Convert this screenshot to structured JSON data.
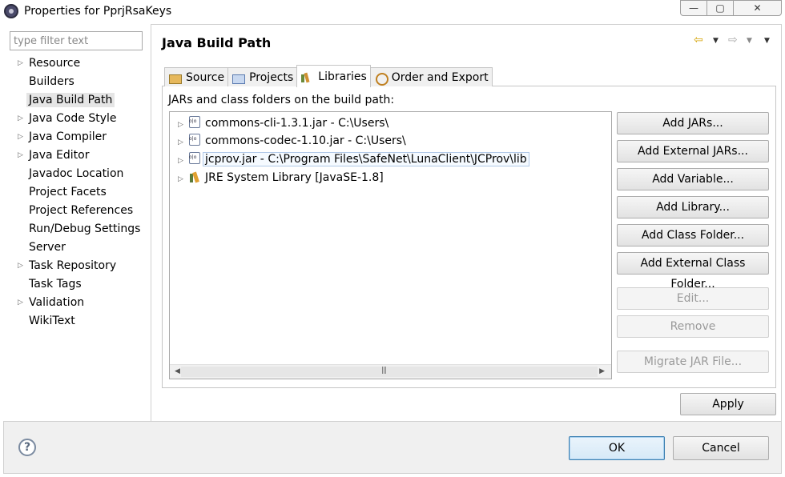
{
  "window": {
    "title": "Properties for PprjRsaKeys",
    "minimize": "—",
    "maximize": "▢",
    "close": "✕"
  },
  "nav": {
    "filter_placeholder": "type filter text",
    "items": [
      {
        "label": "Resource",
        "expandable": true
      },
      {
        "label": "Builders",
        "expandable": false
      },
      {
        "label": "Java Build Path",
        "expandable": false,
        "selected": true
      },
      {
        "label": "Java Code Style",
        "expandable": true
      },
      {
        "label": "Java Compiler",
        "expandable": true
      },
      {
        "label": "Java Editor",
        "expandable": true
      },
      {
        "label": "Javadoc Location",
        "expandable": false
      },
      {
        "label": "Project Facets",
        "expandable": false
      },
      {
        "label": "Project References",
        "expandable": false
      },
      {
        "label": "Run/Debug Settings",
        "expandable": false
      },
      {
        "label": "Server",
        "expandable": false
      },
      {
        "label": "Task Repository",
        "expandable": true
      },
      {
        "label": "Task Tags",
        "expandable": false
      },
      {
        "label": "Validation",
        "expandable": true
      },
      {
        "label": "WikiText",
        "expandable": false
      }
    ]
  },
  "pane": {
    "title": "Java Build Path",
    "tabs": [
      {
        "label": "Source",
        "icon": "source-folder-icon"
      },
      {
        "label": "Projects",
        "icon": "projects-folder-icon"
      },
      {
        "label": "Libraries",
        "icon": "libraries-icon",
        "active": true
      },
      {
        "label": "Order and Export",
        "icon": "order-export-icon"
      }
    ],
    "build_path_label": "JARs and class folders on the build path:",
    "entries": [
      {
        "label": "commons-cli-1.3.1.jar - C:\\Users\\",
        "icon": "jar-icon"
      },
      {
        "label": "commons-codec-1.10.jar - C:\\Users\\",
        "icon": "jar-icon"
      },
      {
        "label": "jcprov.jar - C:\\Program Files\\SafeNet\\LunaClient\\JCProv\\lib",
        "icon": "jar-icon",
        "highlight": true
      },
      {
        "label": "JRE System Library [JavaSE-1.8]",
        "icon": "jre-library-icon"
      }
    ],
    "buttons": {
      "add_jars": "Add JARs...",
      "add_external_jars": "Add External JARs...",
      "add_variable": "Add Variable...",
      "add_library": "Add Library...",
      "add_class_folder": "Add Class Folder...",
      "add_external_class_folder": "Add External Class Folder...",
      "edit": "Edit...",
      "remove": "Remove",
      "migrate_jar": "Migrate JAR File..."
    },
    "apply": "Apply"
  },
  "footer": {
    "help": "?",
    "ok": "OK",
    "cancel": "Cancel"
  }
}
